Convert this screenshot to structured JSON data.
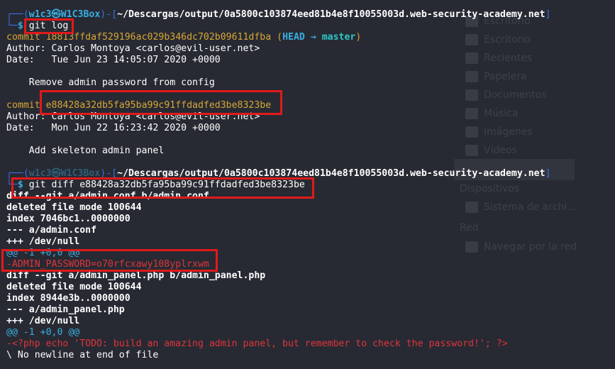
{
  "background_sidebar": {
    "items": [
      "Escritorio",
      "Escritorio",
      "Recientes",
      "Papelera",
      "Documentos",
      "Música",
      "Imágenes",
      "Vídeos"
    ],
    "section_devices": "Dispositivos",
    "device_item": "Sistema de archi...",
    "section_network": "Red",
    "network_item": "Navegar por la red"
  },
  "prompt1": {
    "user": "w1c3",
    "at": "㉿",
    "host": "W1C3Box",
    "path": "~/Descargas/output/0a5800c103874eed81b4e8f10055003d.web-security-academy.net",
    "command": "git log"
  },
  "commit1": {
    "label": "commit",
    "hash": "18813ffdaf529196ac029b346dc702b09611dfba",
    "head": "HEAD",
    "arrow": "→",
    "branch": "master",
    "author": "Author: Carlos Montoya <carlos@evil-user.net>",
    "date": "Date:   Tue Jun 23 14:05:07 2020 +0000",
    "message": "    Remove admin password from config"
  },
  "commit2": {
    "label": "commit",
    "hash": "e88428a32db5fa95ba99c91ffdadfed3be8323be",
    "author": "Author: Carlos Montoya <carlos@evil-user.net>",
    "date": "Date:   Mon Jun 22 16:23:42 2020 +0000",
    "message": "    Add skeleton admin panel"
  },
  "prompt2": {
    "user": "w1c3",
    "at": "㉿",
    "host": "W1C3Box",
    "path": "~/Descargas/output/0a5800c103874eed81b4e8f10055003d.web-security-academy.net",
    "command": "git diff e88428a32db5fa95ba99c91ffdadfed3be8323be"
  },
  "diff1": {
    "header": "diff --git a/admin.conf b/admin.conf",
    "mode": "deleted file mode 100644",
    "index": "index 7046bc1..0000000",
    "minus": "--- a/admin.conf",
    "plus": "+++ /dev/null",
    "hunk": "@@ -1 +0,0 @@",
    "removed": "-ADMIN_PASSWORD=o70rfcxawy108yplrxwm"
  },
  "diff2": {
    "header": "diff --git a/admin_panel.php b/admin_panel.php",
    "mode": "deleted file mode 100644",
    "index": "index 8944e3b..0000000",
    "minus": "--- a/admin_panel.php",
    "plus": "+++ /dev/null",
    "hunk": "@@ -1 +0,0 @@",
    "removed": "-<?php echo 'TODO: build an amazing admin panel, but remember to check the password!'; ?>",
    "note": "\\ No newline at end of file"
  },
  "colors": {
    "background": "#272a33",
    "highlight_box": "#e11a1a",
    "prompt_user": "#39aee0",
    "prompt_frame": "#3d6fe6",
    "commit_hash": "#d9a735",
    "head_label": "#39aee0",
    "branch_label": "#2ec7c7",
    "diff_removed": "#e0343c",
    "diff_hunk": "#39aee0"
  }
}
